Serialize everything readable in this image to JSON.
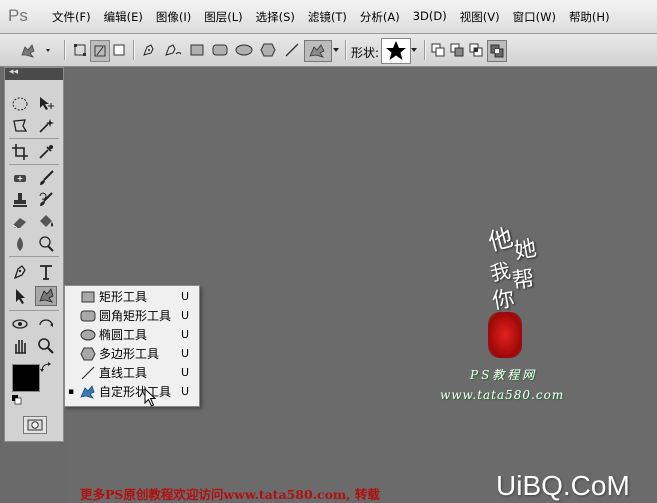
{
  "app": {
    "logo": "Ps"
  },
  "menubar": {
    "items": [
      "文件(F)",
      "编辑(E)",
      "图像(I)",
      "图层(L)",
      "选择(S)",
      "滤镜(T)",
      "分析(A)",
      "3D(D)",
      "视图(V)",
      "窗口(W)",
      "帮助(H)"
    ]
  },
  "options_bar": {
    "shape_label": "形状:"
  },
  "toolbox": {
    "collapse_glyph": "◂◂"
  },
  "flyout": {
    "items": [
      {
        "label": "矩形工具",
        "shortcut": "U",
        "icon": "rectangle-icon",
        "selected": false
      },
      {
        "label": "圆角矩形工具",
        "shortcut": "U",
        "icon": "rounded-rectangle-icon",
        "selected": false
      },
      {
        "label": "椭圆工具",
        "shortcut": "U",
        "icon": "ellipse-icon",
        "selected": false
      },
      {
        "label": "多边形工具",
        "shortcut": "U",
        "icon": "polygon-icon",
        "selected": false
      },
      {
        "label": "直线工具",
        "shortcut": "U",
        "icon": "line-icon",
        "selected": false
      },
      {
        "label": "自定形状工具",
        "shortcut": "U",
        "icon": "custom-shape-icon",
        "selected": true
      }
    ],
    "bullet": "▪"
  },
  "watermarks": {
    "calligraphy": [
      "他",
      "她",
      "我",
      "帮",
      "你"
    ],
    "site_name": "PS教程网",
    "site_url": "www.tata580.com",
    "footer_text": "更多PS原创教程欢迎访问www.tata580.com, 转载",
    "brand": "UiBQ.CoM"
  },
  "colors": {
    "foreground": "#000000",
    "background": "#ffffff",
    "watermark_red": "#b01010",
    "watermark_green": "#1a6a2a"
  }
}
